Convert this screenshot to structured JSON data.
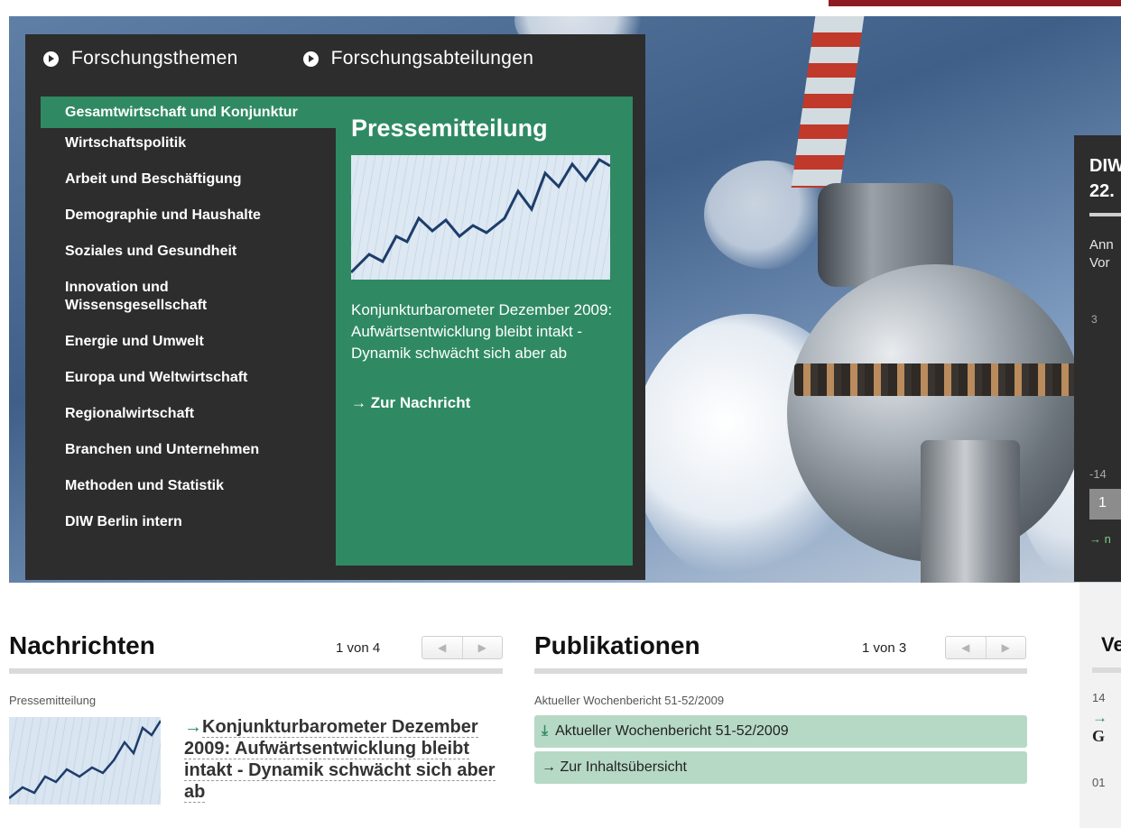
{
  "tabs": [
    {
      "label": "Forschungsthemen"
    },
    {
      "label": "Forschungsabteilungen"
    }
  ],
  "topics": [
    {
      "label": "Gesamtwirtschaft und Konjunktur"
    },
    {
      "label": "Wirtschaftspolitik"
    },
    {
      "label": "Arbeit und Beschäftigung"
    },
    {
      "label": "Demographie und Haushalte"
    },
    {
      "label": "Soziales und Gesundheit"
    },
    {
      "label": "Innovation und Wissensgesellschaft"
    },
    {
      "label": "Energie und Umwelt"
    },
    {
      "label": "Europa und Weltwirtschaft"
    },
    {
      "label": "Regionalwirtschaft"
    },
    {
      "label": "Branchen und Unternehmen"
    },
    {
      "label": "Methoden und Statistik"
    },
    {
      "label": "DIW Berlin intern"
    }
  ],
  "press": {
    "title": "Pressemitteilung",
    "text": "Konjunkturbarometer Dezember 2009: Aufwärtsentwicklung bleibt intakt - Dynamik schwächt sich aber ab",
    "link": "→ Zur Nachricht"
  },
  "side_box": {
    "title_line1": "DIW",
    "title_line2": "22.",
    "text_line1": "Ann",
    "text_line2": "Vor",
    "value_top": "3",
    "value_bottom": "-14",
    "button": "1",
    "link": "→ n"
  },
  "nachrichten": {
    "title": "Nachrichten",
    "pager": "1 von 4",
    "kicker": "Pressemitteilung",
    "link_arrow": "→",
    "link_text": "Konjunkturbarometer Dezember 2009: Aufwärtsentwicklung bleibt intakt - Dynamik schwächt sich aber ab"
  },
  "publikationen": {
    "title": "Publikationen",
    "pager": "1 von 3",
    "kicker": "Aktueller Wochenbericht 51-52/2009",
    "row1": "Aktueller Wochenbericht 51-52/2009",
    "row2": "→ Zur Inhaltsübersicht"
  },
  "right_col": {
    "title": "Ve",
    "date1": "14",
    "arrow": "→",
    "text": "G",
    "date2": "01"
  },
  "pager_prev": "◀",
  "pager_next": "▶",
  "colors": {
    "accent_green": "#2f8a63",
    "dark_panel": "#2d2d2d",
    "brand_red": "#8e1b22",
    "row_green": "#b6d9c6"
  }
}
